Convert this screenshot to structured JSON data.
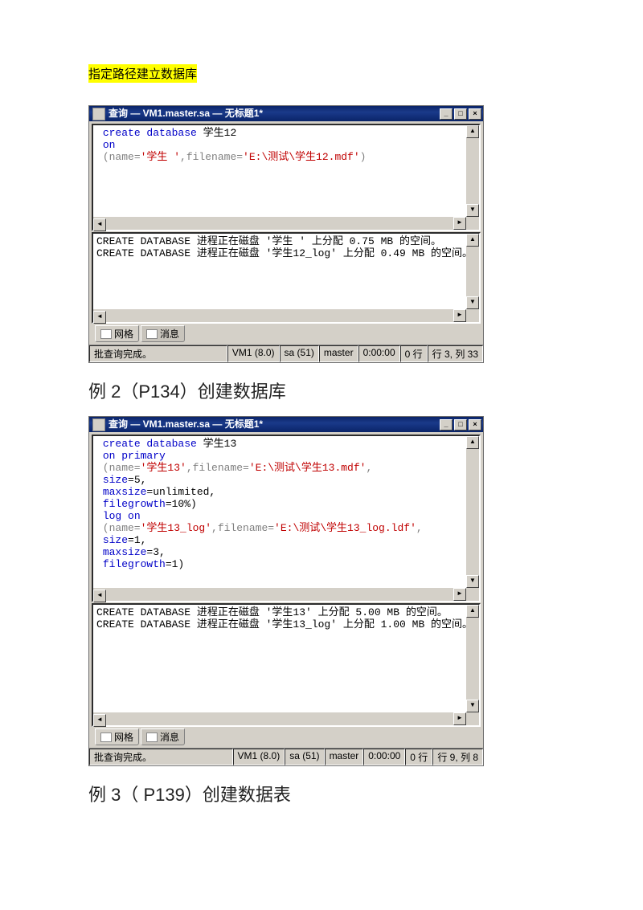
{
  "doc": {
    "section_title": "指定路径建立数据库",
    "heading2": "例 2（P134）创建数据库",
    "heading3": "例 3（ P139）创建数据表"
  },
  "win1": {
    "title": "查询 — VM1.master.sa — 无标题1*",
    "code": {
      "l1a": "create database",
      "l1b": " 学生12",
      "l2": "on",
      "l3a": "(name=",
      "l3b": "'学生 '",
      "l3c": ",filename=",
      "l3d": "'E:\\测试\\学生12.mdf'",
      "l3e": ")"
    },
    "msg1": "CREATE DATABASE 进程正在磁盘 '学生 ' 上分配 0.75 MB 的空间。",
    "msg2": "CREATE DATABASE 进程正在磁盘 '学生12_log' 上分配 0.49 MB 的空间。",
    "tab1": "网格",
    "tab2": "消息",
    "status": {
      "s1": "批查询完成。",
      "s2": "VM1 (8.0)",
      "s3": "sa (51)",
      "s4": "master",
      "s5": "0:00:00",
      "s6": "0 行",
      "s7": "行 3, 列 33"
    }
  },
  "win2": {
    "title": "查询 — VM1.master.sa — 无标题1*",
    "code": {
      "l1a": "create database",
      "l1b": " 学生13",
      "l2": "on primary",
      "l3a": " (name=",
      "l3b": "'学生13'",
      "l3c": ",filename=",
      "l3d": "'E:\\测试\\学生13.mdf'",
      "l3e": ",",
      "l4a": "size",
      "l4b": "=5,",
      "l5a": "maxsize",
      "l5b": "=unlimited,",
      "l6a": "filegrowth",
      "l6b": "=10%)",
      "l7": "log on",
      "l8a": " (name=",
      "l8b": "'学生13_log'",
      "l8c": ",filename=",
      "l8d": "'E:\\测试\\学生13_log.ldf'",
      "l8e": ",",
      "l9a": "size",
      "l9b": "=1,",
      "l10a": "maxsize",
      "l10b": "=3,",
      "l11a": "filegrowth",
      "l11b": "=1)"
    },
    "msg1": "CREATE DATABASE 进程正在磁盘 '学生13' 上分配 5.00 MB 的空间。",
    "msg2": "CREATE DATABASE 进程正在磁盘 '学生13_log' 上分配 1.00 MB 的空间。",
    "tab1": "网格",
    "tab2": "消息",
    "status": {
      "s1": "批查询完成。",
      "s2": "VM1 (8.0)",
      "s3": "sa (51)",
      "s4": "master",
      "s5": "0:00:00",
      "s6": "0 行",
      "s7": "行 9, 列 8"
    }
  }
}
